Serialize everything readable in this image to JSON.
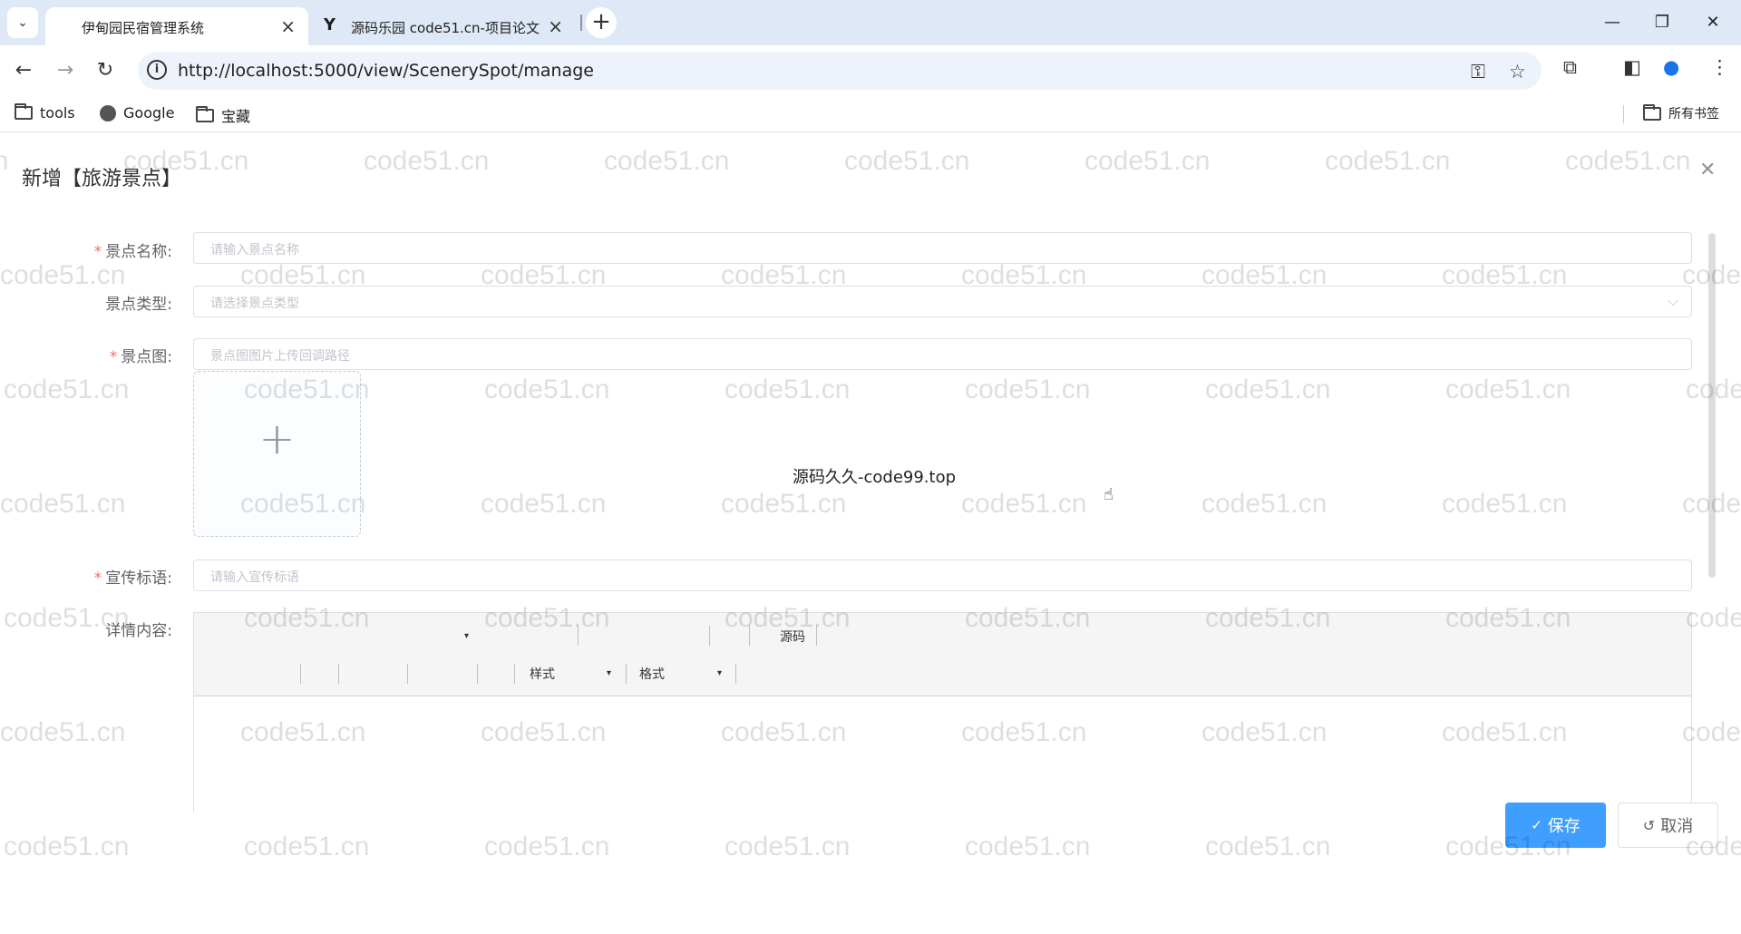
{
  "browser": {
    "tabs": [
      {
        "title": "伊甸园民宿管理系统",
        "active": true
      },
      {
        "title": "源码乐园 code51.cn-项目论文",
        "active": false
      }
    ],
    "url": "http://localhost:5000/view/ScenerySpot/manage",
    "bookmarks": [
      {
        "label": "tools",
        "icon": "folder-icon"
      },
      {
        "label": "Google",
        "icon": "globe-icon"
      },
      {
        "label": "宝藏",
        "icon": "folder-icon"
      }
    ],
    "all_bookmarks_label": "所有书签"
  },
  "dialog": {
    "title": "新增【旅游景点】",
    "fields": {
      "name": {
        "label": "景点名称:",
        "required": true,
        "placeholder": "请输入景点名称"
      },
      "type": {
        "label": "景点类型:",
        "required": false,
        "placeholder": "请选择景点类型"
      },
      "image": {
        "label": "景点图:",
        "required": true,
        "placeholder": "景点图图片上传回调路径"
      },
      "slogan": {
        "label": "宣传标语:",
        "required": true,
        "placeholder": "请输入宣传标语"
      },
      "detail": {
        "label": "详情内容:",
        "required": false
      }
    },
    "editor": {
      "source_label": "源码",
      "style_label": "样式",
      "format_label": "格式"
    },
    "overlay_text": "源码久久-code99.top",
    "buttons": {
      "save": "保存",
      "cancel": "取消"
    }
  },
  "watermark": "code51.cn",
  "colors": {
    "primary": "#409eff",
    "required": "#f56c6c"
  }
}
